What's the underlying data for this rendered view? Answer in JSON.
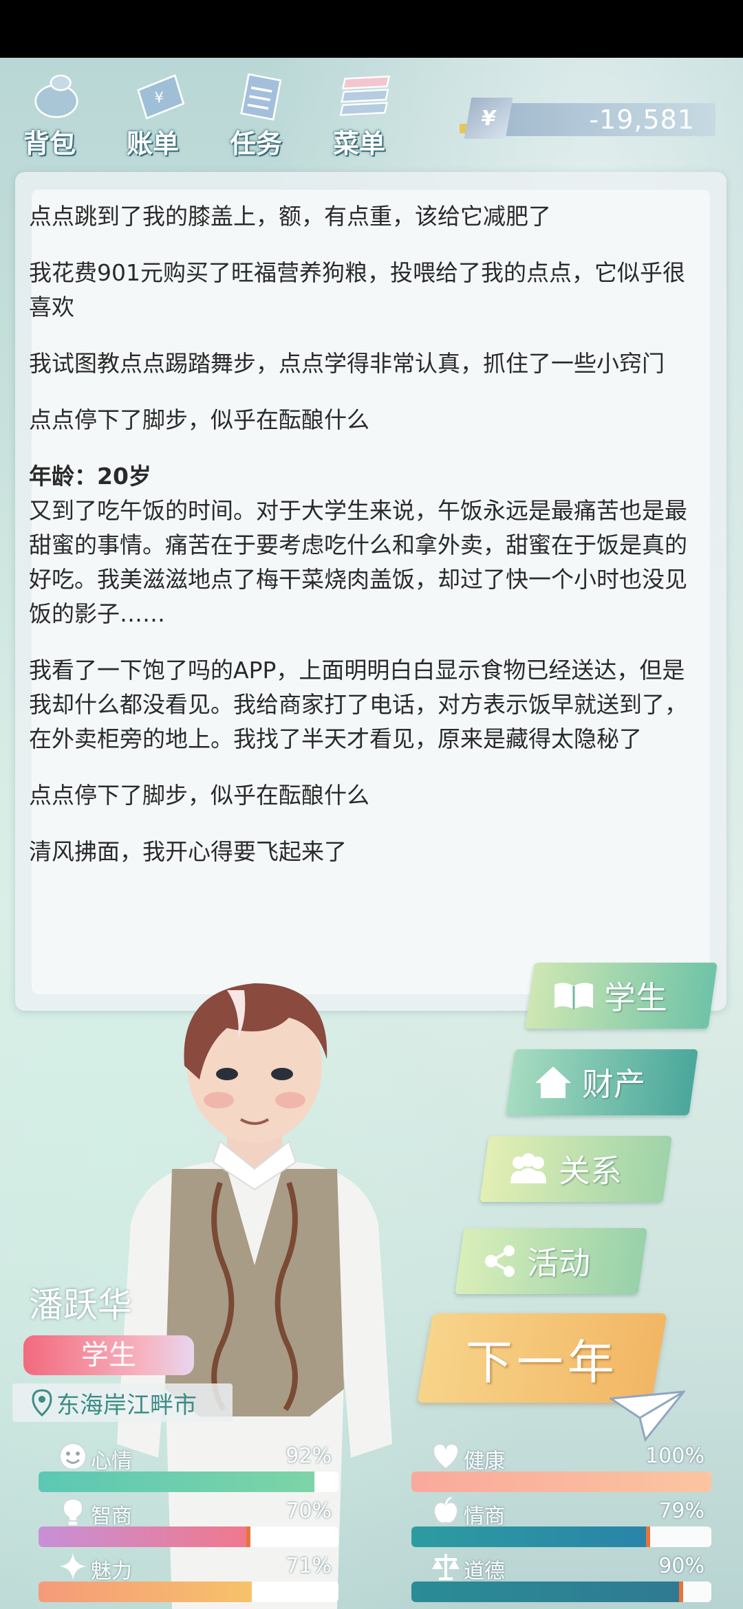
{
  "nav": [
    {
      "label": "背包",
      "icon": "backpack-icon"
    },
    {
      "label": "账单",
      "icon": "bill-icon"
    },
    {
      "label": "任务",
      "icon": "task-icon"
    },
    {
      "label": "菜单",
      "icon": "menu-icon"
    }
  ],
  "money": {
    "symbol": "¥",
    "amount": "-19,581"
  },
  "log": [
    {
      "text": "点点跳到了我的膝盖上，额，有点重，该给它减肥了"
    },
    {
      "text": "我花费901元购买了旺福营养狗粮，投喂给了我的点点，它似乎很喜欢"
    },
    {
      "text": "我试图教点点踢踏舞步，点点学得非常认真，抓住了一些小窍门"
    },
    {
      "text": "点点停下了脚步，似乎在酝酿什么"
    },
    {
      "age": "年龄：20岁"
    },
    {
      "text": "又到了吃午饭的时间。对于大学生来说，午饭永远是最痛苦也是最甜蜜的事情。痛苦在于要考虑吃什么和拿外卖，甜蜜在于饭是真的好吃。我美滋滋地点了梅干菜烧肉盖饭，却过了快一个小时也没见饭的影子……"
    },
    {
      "text": "我看了一下饱了吗的APP，上面明明白白显示食物已经送达，但是我却什么都没看见。我给商家打了电话，对方表示饭早就送到了，在外卖柜旁的地上。我找了半天才看见，原来是藏得太隐秘了"
    },
    {
      "text": "点点停下了脚步，似乎在酝酿什么"
    },
    {
      "text": "清风拂面，我开心得要飞起来了"
    }
  ],
  "actions": {
    "student": "学生",
    "assets": "财产",
    "relations": "关系",
    "activities": "活动",
    "next_year": "下一年"
  },
  "character": {
    "name": "潘跃华",
    "role": "学生",
    "location": "东海岸江畔市"
  },
  "stats": [
    {
      "key": "mood",
      "label": "心情",
      "value": "92%",
      "fraction": 0.92,
      "icon": "smiley-icon",
      "color": "#5cc8b4",
      "color2": "#7dd4a7"
    },
    {
      "key": "health",
      "label": "健康",
      "value": "100%",
      "fraction": 1.0,
      "icon": "heart-icon",
      "color": "#f9a99c",
      "color2": "#fbc5a0"
    },
    {
      "key": "iq",
      "label": "智商",
      "value": "70%",
      "fraction": 0.7,
      "icon": "bulb-icon",
      "color": "#c890d6",
      "color2": "#f0788c"
    },
    {
      "key": "eq",
      "label": "情商",
      "value": "79%",
      "fraction": 0.79,
      "icon": "apple-icon",
      "color": "#2c9ca0",
      "color2": "#2a84a8"
    },
    {
      "key": "charm",
      "label": "魅力",
      "value": "71%",
      "fraction": 0.71,
      "icon": "sparkle-icon",
      "color": "#f59a7a",
      "color2": "#f7c26a"
    },
    {
      "key": "morality",
      "label": "道德",
      "value": "90%",
      "fraction": 0.9,
      "icon": "scale-icon",
      "color": "#2a8c96",
      "color2": "#2f7a92"
    }
  ]
}
